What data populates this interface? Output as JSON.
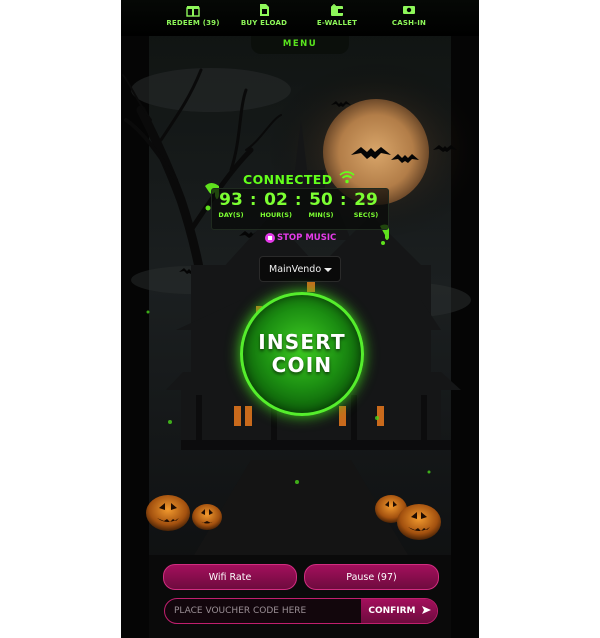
{
  "nav": {
    "items": [
      {
        "label": "REDEEM (39)",
        "icon": "gift-icon"
      },
      {
        "label": "BUY ELOAD",
        "icon": "sim-card-icon"
      },
      {
        "label": "E-WALLET",
        "icon": "wallet-icon"
      },
      {
        "label": "CASH-IN",
        "icon": "cash-icon"
      }
    ],
    "menu_label": "MENU"
  },
  "status": {
    "connected_label": "CONNECTED",
    "timer": {
      "days": "93",
      "hours": "02",
      "mins": "50",
      "secs": "29",
      "days_label": "DAY(S)",
      "hours_label": "HOUR(S)",
      "mins_label": "MIN(S)",
      "secs_label": "SEC(S)"
    },
    "stop_music_label": "STOP MUSIC"
  },
  "vendo": {
    "selected": "MainVendo"
  },
  "insert_coin": {
    "line1": "INSERT",
    "line2": "COIN"
  },
  "buttons": {
    "wifi_rate": "Wifi Rate",
    "pause": "Pause (97)"
  },
  "voucher": {
    "placeholder": "PLACE VOUCHER CODE HERE",
    "confirm_label": "CONFIRM"
  },
  "colors": {
    "accent_green": "#63ff1b",
    "accent_magenta": "#a30f5c",
    "stop_music": "#e63bea"
  }
}
